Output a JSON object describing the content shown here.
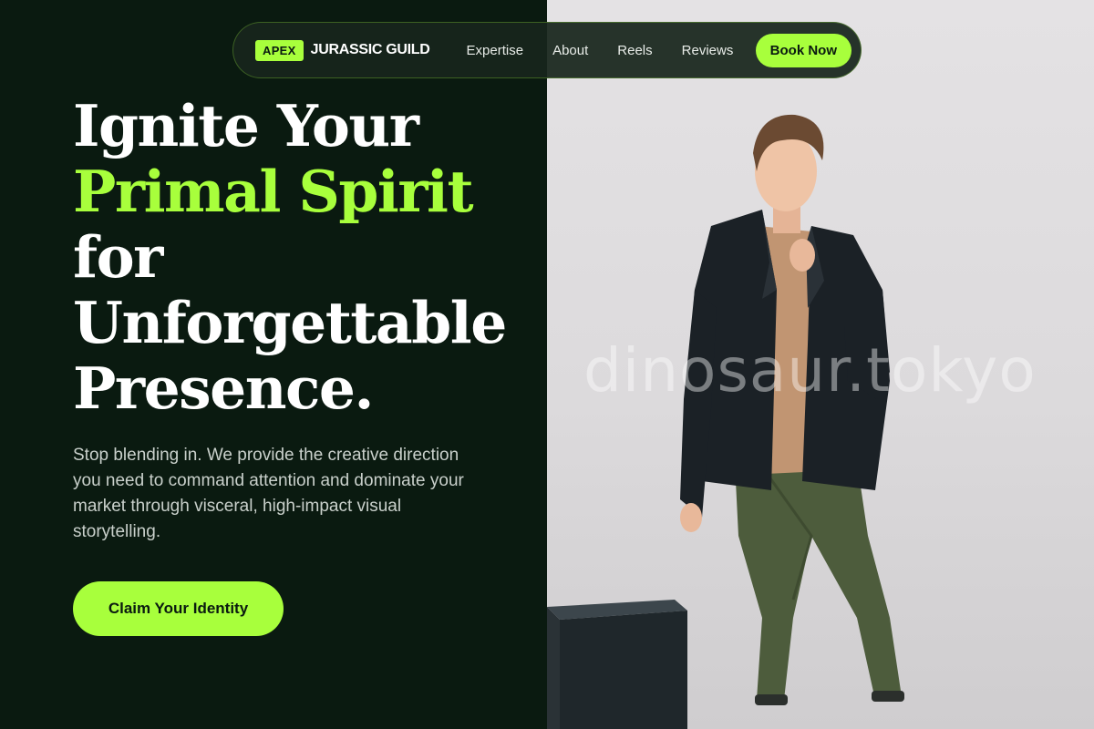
{
  "nav": {
    "brand_badge": "APEX",
    "brand_name": "JURASSIC GUILD",
    "links": [
      "Expertise",
      "About",
      "Reels",
      "Reviews"
    ],
    "cta": "Book Now"
  },
  "hero": {
    "title_lines": [
      "Ignite Your",
      "Primal Spirit",
      "for",
      "Unforgettable",
      "Presence."
    ],
    "description": "Stop blending in. We provide the creative direction you need to command attention and dominate your market through visceral, high-impact visual storytelling.",
    "cta": "Claim Your Identity"
  },
  "photo": {
    "watermark": "dinosaur.tokyo"
  },
  "colors": {
    "accent": "#a8ff3c",
    "background": "#0a1a10"
  }
}
